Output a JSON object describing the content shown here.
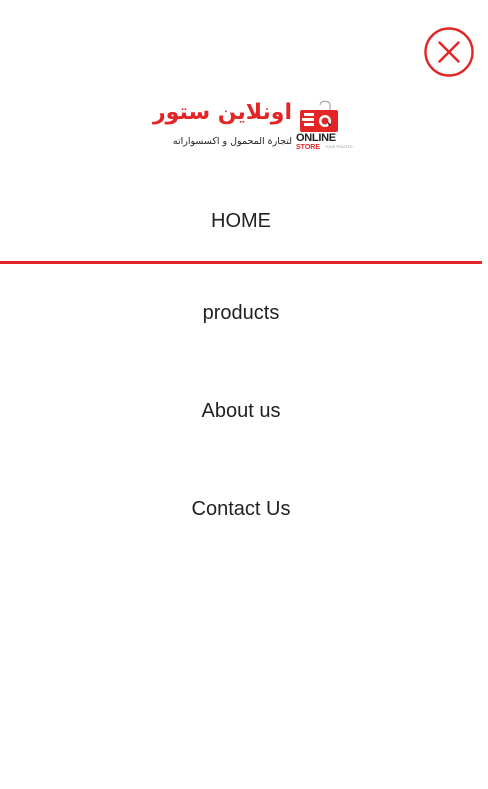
{
  "colors": {
    "accent": "#e32526",
    "text": "#222222",
    "background": "#ffffff"
  },
  "header": {
    "close_icon": "close-circle-icon"
  },
  "logo": {
    "arabic_name": "اونلاين ستور",
    "arabic_tagline": "لتجارة المحمول و اكسسواراته",
    "word_online": "ONLINE",
    "word_store": "STORE",
    "word_small": "YOUR TRUSTED"
  },
  "nav": {
    "items": [
      {
        "label": "HOME",
        "active": true
      },
      {
        "label": "products",
        "active": false
      },
      {
        "label": "About us",
        "active": false
      },
      {
        "label": "Contact Us",
        "active": false
      }
    ]
  }
}
